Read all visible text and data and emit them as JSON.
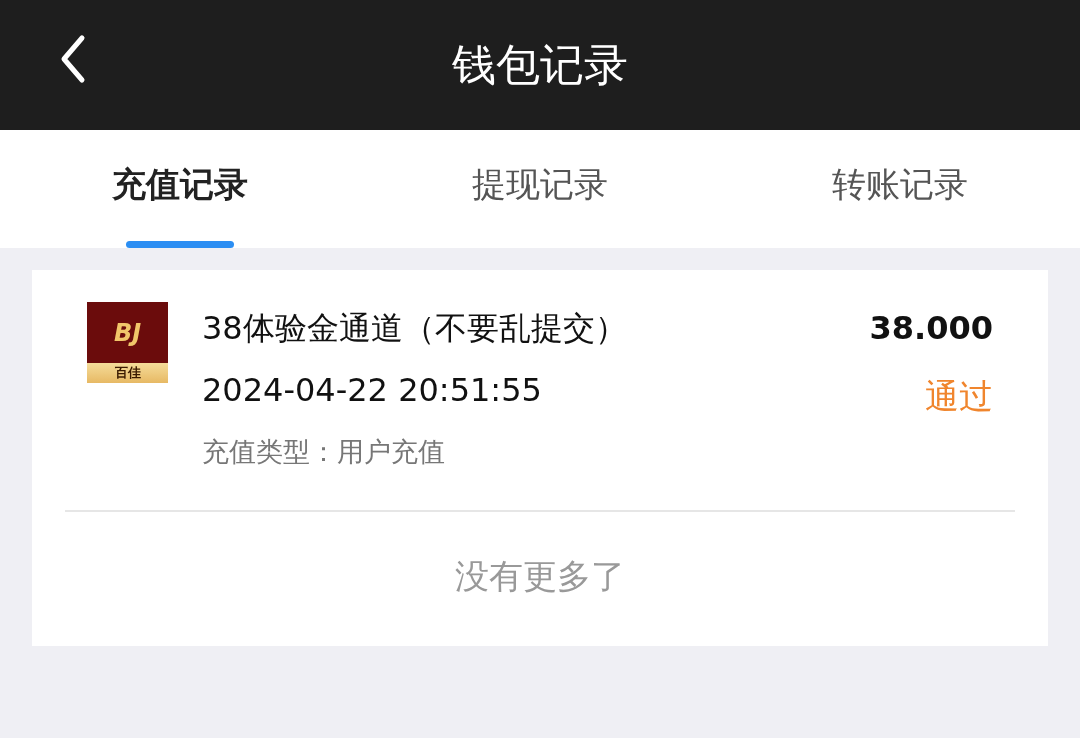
{
  "header": {
    "title": "钱包记录"
  },
  "tabs": [
    {
      "label": "充值记录",
      "selected": true
    },
    {
      "label": "提现记录",
      "selected": false
    },
    {
      "label": "转账记录",
      "selected": false
    }
  ],
  "records": [
    {
      "logo": {
        "initials": "BJ",
        "name": "百佳"
      },
      "title": "38体验金通道（不要乱提交）",
      "time": "2024-04-22 20:51:55",
      "type_label": "充值类型：",
      "type_value": "用户充值",
      "amount": "38.000",
      "status": "通过"
    }
  ],
  "footer_note": "没有更多了"
}
